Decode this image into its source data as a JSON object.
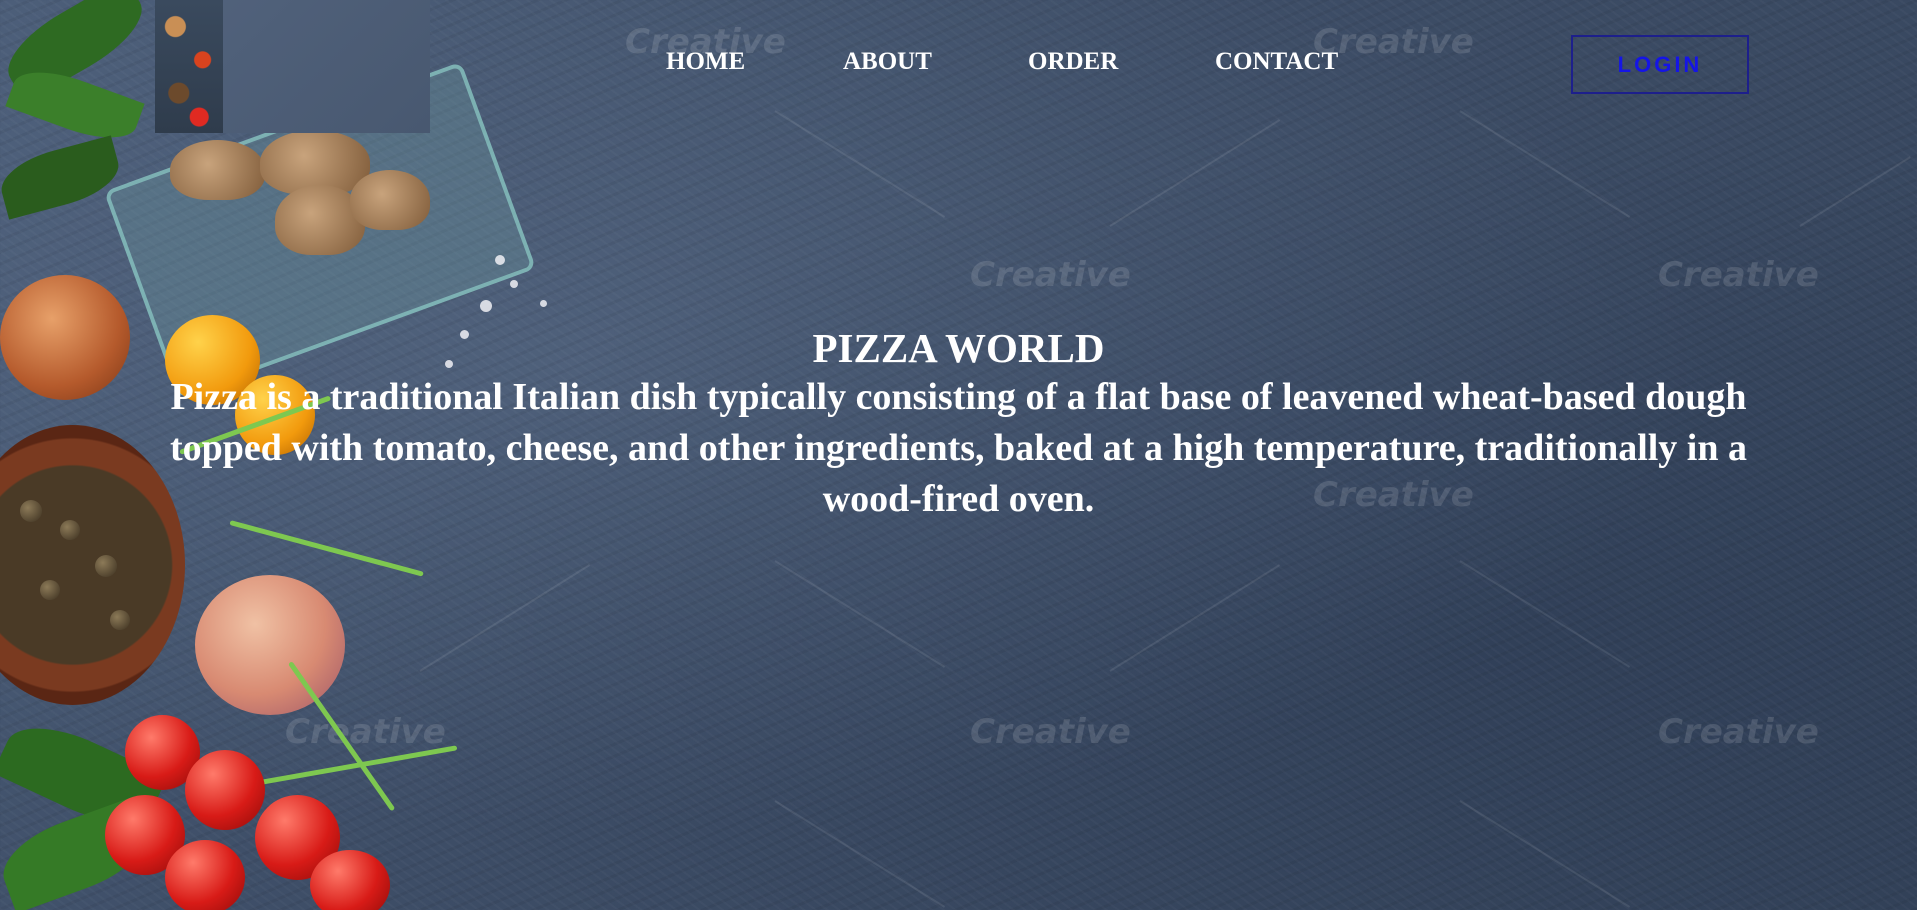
{
  "logo": {
    "alt": "Pizza World logo"
  },
  "nav": {
    "items": [
      {
        "label": "HOME"
      },
      {
        "label": "ABOUT"
      },
      {
        "label": "ORDER"
      },
      {
        "label": "CONTACT"
      }
    ],
    "login_label": "LOGIN"
  },
  "hero": {
    "title": "PIZZA WORLD",
    "description": "Pizza is a traditional Italian dish typically consisting of a flat base of leavened wheat-based dough topped with tomato, cheese, and other ingredients, baked at a high temperature, traditionally in a wood-fired oven."
  },
  "background": {
    "watermark_text": "Creative",
    "base_color": "#3f4f68"
  },
  "colors": {
    "login_text": "#1515e6",
    "login_border": "#1d1f8c",
    "nav_text": "#ffffff"
  }
}
